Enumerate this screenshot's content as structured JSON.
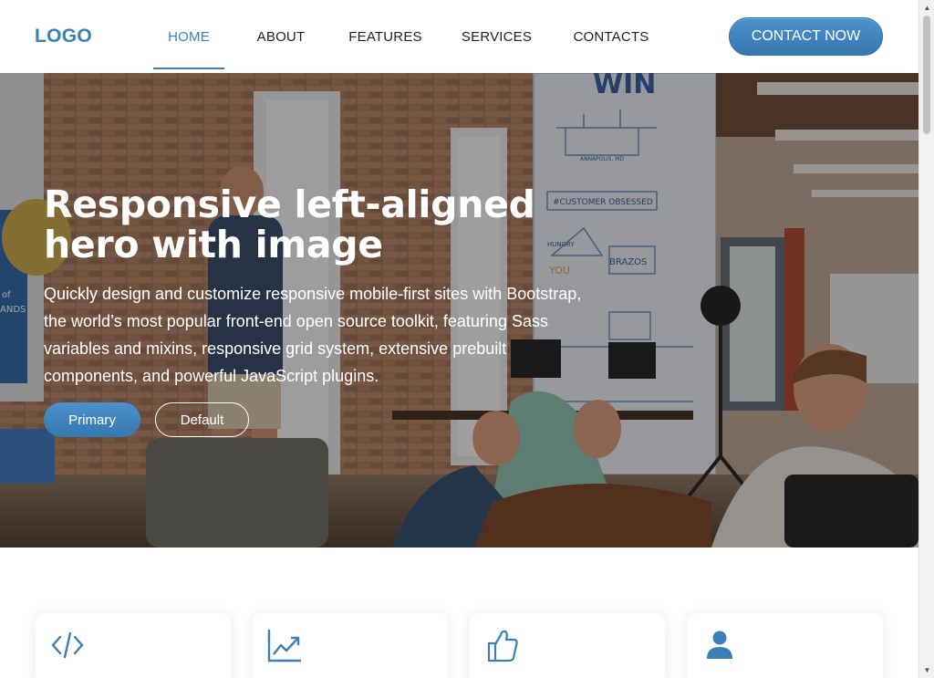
{
  "header": {
    "logo": "LOGO",
    "nav": [
      {
        "label": "HOME",
        "active": true
      },
      {
        "label": "ABOUT",
        "active": false
      },
      {
        "label": "FEATURES",
        "active": false
      },
      {
        "label": "SERVICES",
        "active": false
      },
      {
        "label": "CONTACTS",
        "active": false
      }
    ],
    "cta_label": "CONTACT NOW"
  },
  "hero": {
    "title_line1": "Responsive left-aligned",
    "title_line2": "hero with image",
    "description": "Quickly design and customize responsive mobile-first sites with Bootstrap, the world’s most popular front-end open source toolkit, featuring Sass variables and mixins, responsive grid system, extensive prebuilt components, and powerful JavaScript plugins.",
    "primary_label": "Primary",
    "default_label": "Default",
    "photo_signs": {
      "win": "WIN",
      "customer_obsessed": "#CUSTOMER OBSESSED",
      "brazos": "BRAZOS",
      "hungry": "HUNGRY",
      "you": "YOU",
      "annapolis": "ANNAPOLIS, MD",
      "screen_frag_1": "of",
      "screen_frag_2": "ANDS"
    }
  },
  "features": {
    "cards": [
      {
        "icon": "code-icon"
      },
      {
        "icon": "chart-line-icon"
      },
      {
        "icon": "thumbs-up-icon"
      },
      {
        "icon": "user-icon"
      }
    ]
  },
  "colors": {
    "accent": "#3a7fb8",
    "text_dark": "#222222"
  }
}
